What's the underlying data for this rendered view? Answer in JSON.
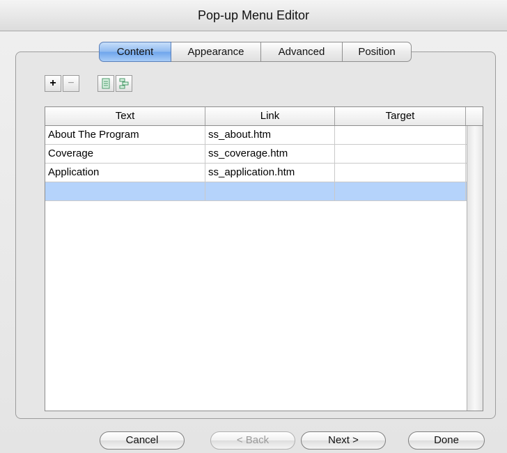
{
  "window": {
    "title": "Pop-up Menu Editor"
  },
  "tabs": [
    {
      "label": "Content",
      "selected": true
    },
    {
      "label": "Appearance",
      "selected": false
    },
    {
      "label": "Advanced",
      "selected": false
    },
    {
      "label": "Position",
      "selected": false
    }
  ],
  "toolbar": {
    "add_label": "+",
    "remove_label": "−",
    "icons": [
      "list-indent-icon",
      "list-outdent-icon"
    ]
  },
  "table": {
    "columns": [
      "Text",
      "Link",
      "Target"
    ],
    "rows": [
      {
        "text": "About The Program",
        "link": "ss_about.htm",
        "target": ""
      },
      {
        "text": "Coverage",
        "link": "ss_coverage.htm",
        "target": ""
      },
      {
        "text": "Application",
        "link": "ss_application.htm",
        "target": ""
      },
      {
        "text": "",
        "link": "",
        "target": ""
      }
    ],
    "selected_row_color": "#b5d3fb"
  },
  "buttons": {
    "cancel": "Cancel",
    "back": "< Back",
    "next": "Next >",
    "done": "Done"
  },
  "colors": {
    "accent": "#6ea5ec"
  }
}
